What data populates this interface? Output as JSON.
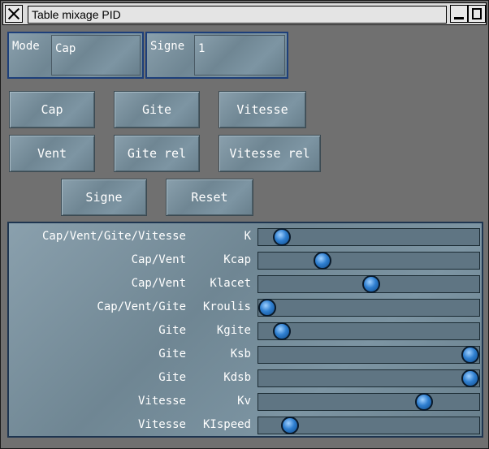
{
  "window": {
    "title": "Table mixage PID"
  },
  "mode": {
    "label": "Mode",
    "value": "Cap"
  },
  "signe": {
    "label": "Signe",
    "value": "1"
  },
  "buttons": {
    "cap": "Cap",
    "gite": "Gite",
    "vitesse": "Vitesse",
    "vent": "Vent",
    "gite_rel": "Gite rel",
    "vitesse_rel": "Vitesse rel",
    "signe": "Signe",
    "reset": "Reset"
  },
  "sliders": [
    {
      "group": "Cap/Vent/Gite/Vitesse",
      "name": "K",
      "level": 0.07
    },
    {
      "group": "Cap/Vent",
      "name": "Kcap",
      "level": 0.27
    },
    {
      "group": "Cap/Vent",
      "name": "Klacet",
      "level": 0.51
    },
    {
      "group": "Cap/Vent/Gite",
      "name": "Kroulis",
      "level": 0.0
    },
    {
      "group": "Gite",
      "name": "Kgite",
      "level": 0.07
    },
    {
      "group": "Gite",
      "name": "Ksb",
      "level": 1.0
    },
    {
      "group": "Gite",
      "name": "Kdsb",
      "level": 1.0
    },
    {
      "group": "Vitesse",
      "name": "Kv",
      "level": 0.77
    },
    {
      "group": "Vitesse",
      "name": "KIspeed",
      "level": 0.11
    }
  ]
}
